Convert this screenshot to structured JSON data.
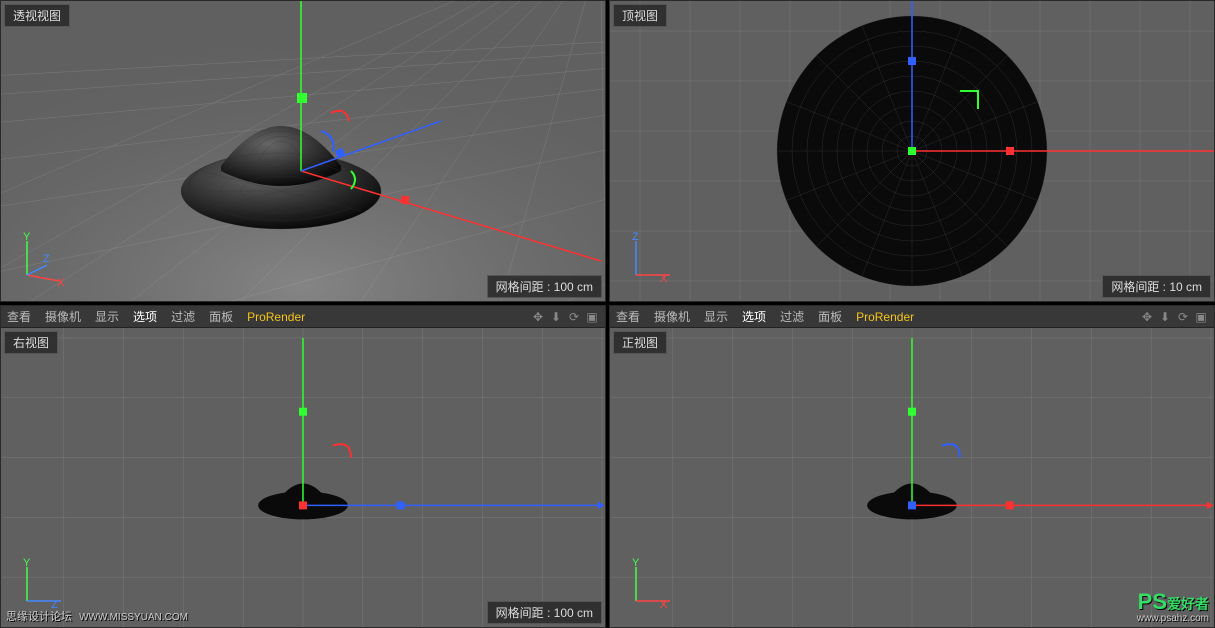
{
  "viewports": {
    "perspective": {
      "label": "透视视图",
      "grid_spacing": "网格间距 : 100 cm"
    },
    "top": {
      "label": "顶视图",
      "grid_spacing": "网格间距 : 10 cm"
    },
    "right": {
      "label": "右视图",
      "grid_spacing": "网格间距 : 100 cm"
    },
    "front": {
      "label": "正视图",
      "grid_spacing": ""
    }
  },
  "menu": {
    "view": "查看",
    "camera": "摄像机",
    "display": "显示",
    "options": "选项",
    "filter": "过滤",
    "panel": "面板",
    "prorender": "ProRender"
  },
  "axes": {
    "x": "X",
    "y": "Y",
    "z": "Z"
  },
  "watermarks": {
    "left_text": "思缘设计论坛",
    "left_url": "WWW.MISSYUAN.COM",
    "right_brand": "PS",
    "right_suffix": "爱好者",
    "right_url": "www.psahz.com"
  }
}
